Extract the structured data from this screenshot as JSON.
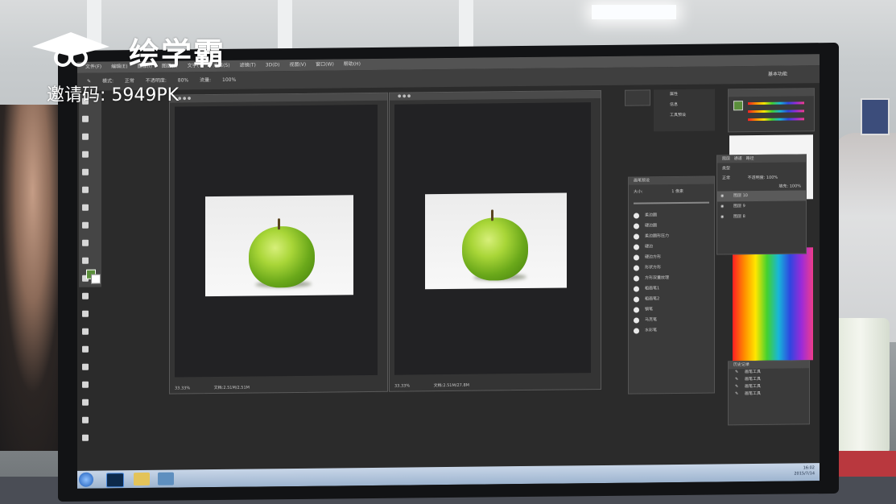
{
  "watermark": {
    "brand": "绘学霸",
    "invite_code": "邀请码: 5949PK"
  },
  "photoshop": {
    "menu_items": [
      "文件(F)",
      "编辑(E)",
      "图像(I)",
      "图层(L)",
      "文字(Y)",
      "选择(S)",
      "滤镜(T)",
      "3D(D)",
      "视图(V)",
      "窗口(W)",
      "帮助(H)"
    ],
    "options": {
      "mode_label": "模式:",
      "mode_value": "正常",
      "opacity_label": "不透明度:",
      "opacity_value": "80%",
      "flow_label": "流量:",
      "flow_value": "100%",
      "workspace": "基本功能"
    },
    "documents": [
      {
        "zoom": "33.33%",
        "doc_size": "文档:2.51M/2.51M"
      },
      {
        "zoom": "33.33%",
        "doc_size": "文档:2.51M/27.8M"
      }
    ],
    "brush_panel": {
      "title": "画笔预设",
      "size_label": "大小:",
      "size_value": "1 像素",
      "presets": [
        "柔边圆",
        "硬边圆",
        "柔边圆形压力",
        "硬边",
        "硬边方形",
        "形状方形",
        "方形双重纹理",
        "粗画笔1",
        "粗画笔2",
        "钢笔",
        "马克笔",
        "水彩笔"
      ]
    },
    "adjust_panel": {
      "items": [
        "属性",
        "信息",
        "工具预设"
      ]
    },
    "layers_panel": {
      "tabs": [
        "图层",
        "通道",
        "路径"
      ],
      "kind": "类型",
      "blend": "正常",
      "opacity_label": "不透明度:",
      "opacity_value": "100%",
      "fill_label": "填充:",
      "fill_value": "100%",
      "layers": [
        "图层 10",
        "图层 9",
        "图层 8"
      ]
    },
    "history_panel": {
      "title": "历史记录",
      "items": [
        "画笔工具",
        "画笔工具",
        "画笔工具",
        "画笔工具"
      ]
    },
    "taskbar": {
      "time": "16:02",
      "date": "2015/7/14"
    },
    "colors": {
      "foreground": "#5b8f3b",
      "background": "#ffffff"
    }
  }
}
